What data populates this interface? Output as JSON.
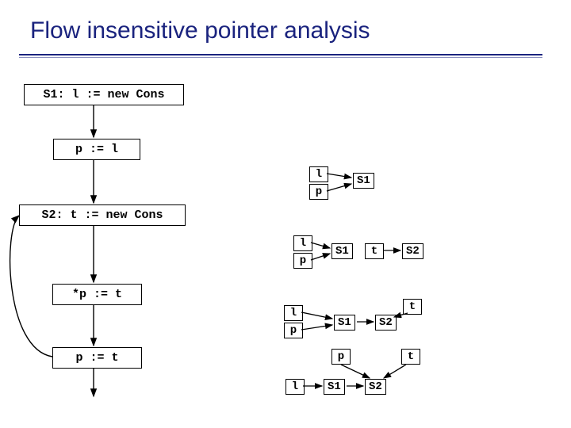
{
  "title": "Flow insensitive pointer analysis",
  "code": {
    "s1": "S1: l := new Cons",
    "s2": "p := l",
    "s3": "S2: t := new Cons",
    "s4": "*p := t",
    "s5": "p := t"
  },
  "chart_data": [
    {
      "type": "flowchart",
      "name": "program-cfg",
      "nodes": [
        "S1: l := new Cons",
        "p := l",
        "S2: t := new Cons",
        "*p := t",
        "p := t"
      ],
      "edges": [
        [
          0,
          1
        ],
        [
          1,
          2
        ],
        [
          2,
          3
        ],
        [
          3,
          4
        ],
        [
          4,
          2
        ]
      ]
    },
    {
      "type": "pointer-graph",
      "name": "after-p-assign-l",
      "nodes": [
        "l",
        "p",
        "S1"
      ],
      "edges": [
        [
          "l",
          "S1"
        ],
        [
          "p",
          "S1"
        ]
      ]
    },
    {
      "type": "pointer-graph",
      "name": "after-t-assign-new",
      "nodes": [
        "l",
        "p",
        "S1",
        "t",
        "S2"
      ],
      "edges": [
        [
          "l",
          "S1"
        ],
        [
          "p",
          "S1"
        ],
        [
          "t",
          "S2"
        ]
      ]
    },
    {
      "type": "pointer-graph",
      "name": "after-star-p-assign-t",
      "nodes": [
        "l",
        "p",
        "S1",
        "S2",
        "t"
      ],
      "edges": [
        [
          "l",
          "S1"
        ],
        [
          "p",
          "S1"
        ],
        [
          "S1",
          "S2"
        ],
        [
          "t",
          "S2"
        ]
      ]
    },
    {
      "type": "pointer-graph",
      "name": "after-p-assign-t",
      "nodes": [
        "l",
        "p",
        "S1",
        "S2",
        "t"
      ],
      "edges": [
        [
          "l",
          "S1"
        ],
        [
          "p",
          "S2"
        ],
        [
          "S1",
          "S2"
        ],
        [
          "t",
          "S2"
        ]
      ]
    }
  ],
  "labels": {
    "l": "l",
    "p": "p",
    "t": "t",
    "s1n": "S1",
    "s2n": "S2"
  }
}
